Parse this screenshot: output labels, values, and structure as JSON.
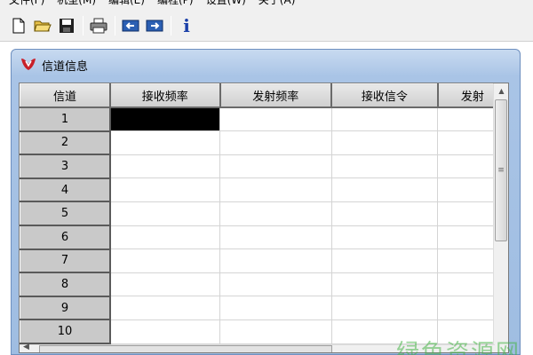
{
  "menubar": {
    "items": [
      "文件(F)",
      "机型(M)",
      "编辑(E)",
      "编程(P)",
      "设置(W)",
      "关于(A)"
    ]
  },
  "toolbar": {
    "icons": [
      "new-file-icon",
      "open-folder-icon",
      "save-icon",
      "print-icon",
      "read-from-radio-icon",
      "write-to-radio-icon",
      "info-icon"
    ],
    "info_glyph": "i"
  },
  "window": {
    "title": "信道信息"
  },
  "grid": {
    "columns": [
      "信道",
      "接收频率",
      "发射频率",
      "接收信令",
      "发射"
    ],
    "rows": [
      "1",
      "2",
      "3",
      "4",
      "5",
      "6",
      "7",
      "8",
      "9",
      "10"
    ],
    "selected_cell": {
      "row": 1,
      "column": "接收频率"
    }
  },
  "watermark": "绿色资源网",
  "colors": {
    "window_frame": "#a9c4e6",
    "row_header": "#c9c9c9",
    "selected_cell": "#000000",
    "watermark": "#46b446"
  }
}
